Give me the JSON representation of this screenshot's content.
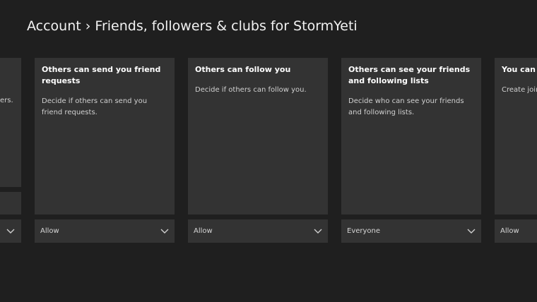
{
  "page": {
    "title": "Account › Friends, followers & clubs for StormYeti"
  },
  "partial_left": {
    "desc_fragment": "ers."
  },
  "cards": [
    {
      "title": "Others can send you friend requests",
      "description": "Decide if others can send you friend requests.",
      "value": "Allow"
    },
    {
      "title": "Others can follow you",
      "description": "Decide if others can follow you.",
      "value": "Allow"
    },
    {
      "title": "Others can see your friends and following lists",
      "description": "Decide who can see your friends and following lists.",
      "value": "Everyone"
    },
    {
      "title": "You can create, join, or leave clubs",
      "description": "Create join, or leave clubs.",
      "value": "Allow"
    }
  ],
  "icons": {
    "dropdown": "chevron-down-icon"
  }
}
